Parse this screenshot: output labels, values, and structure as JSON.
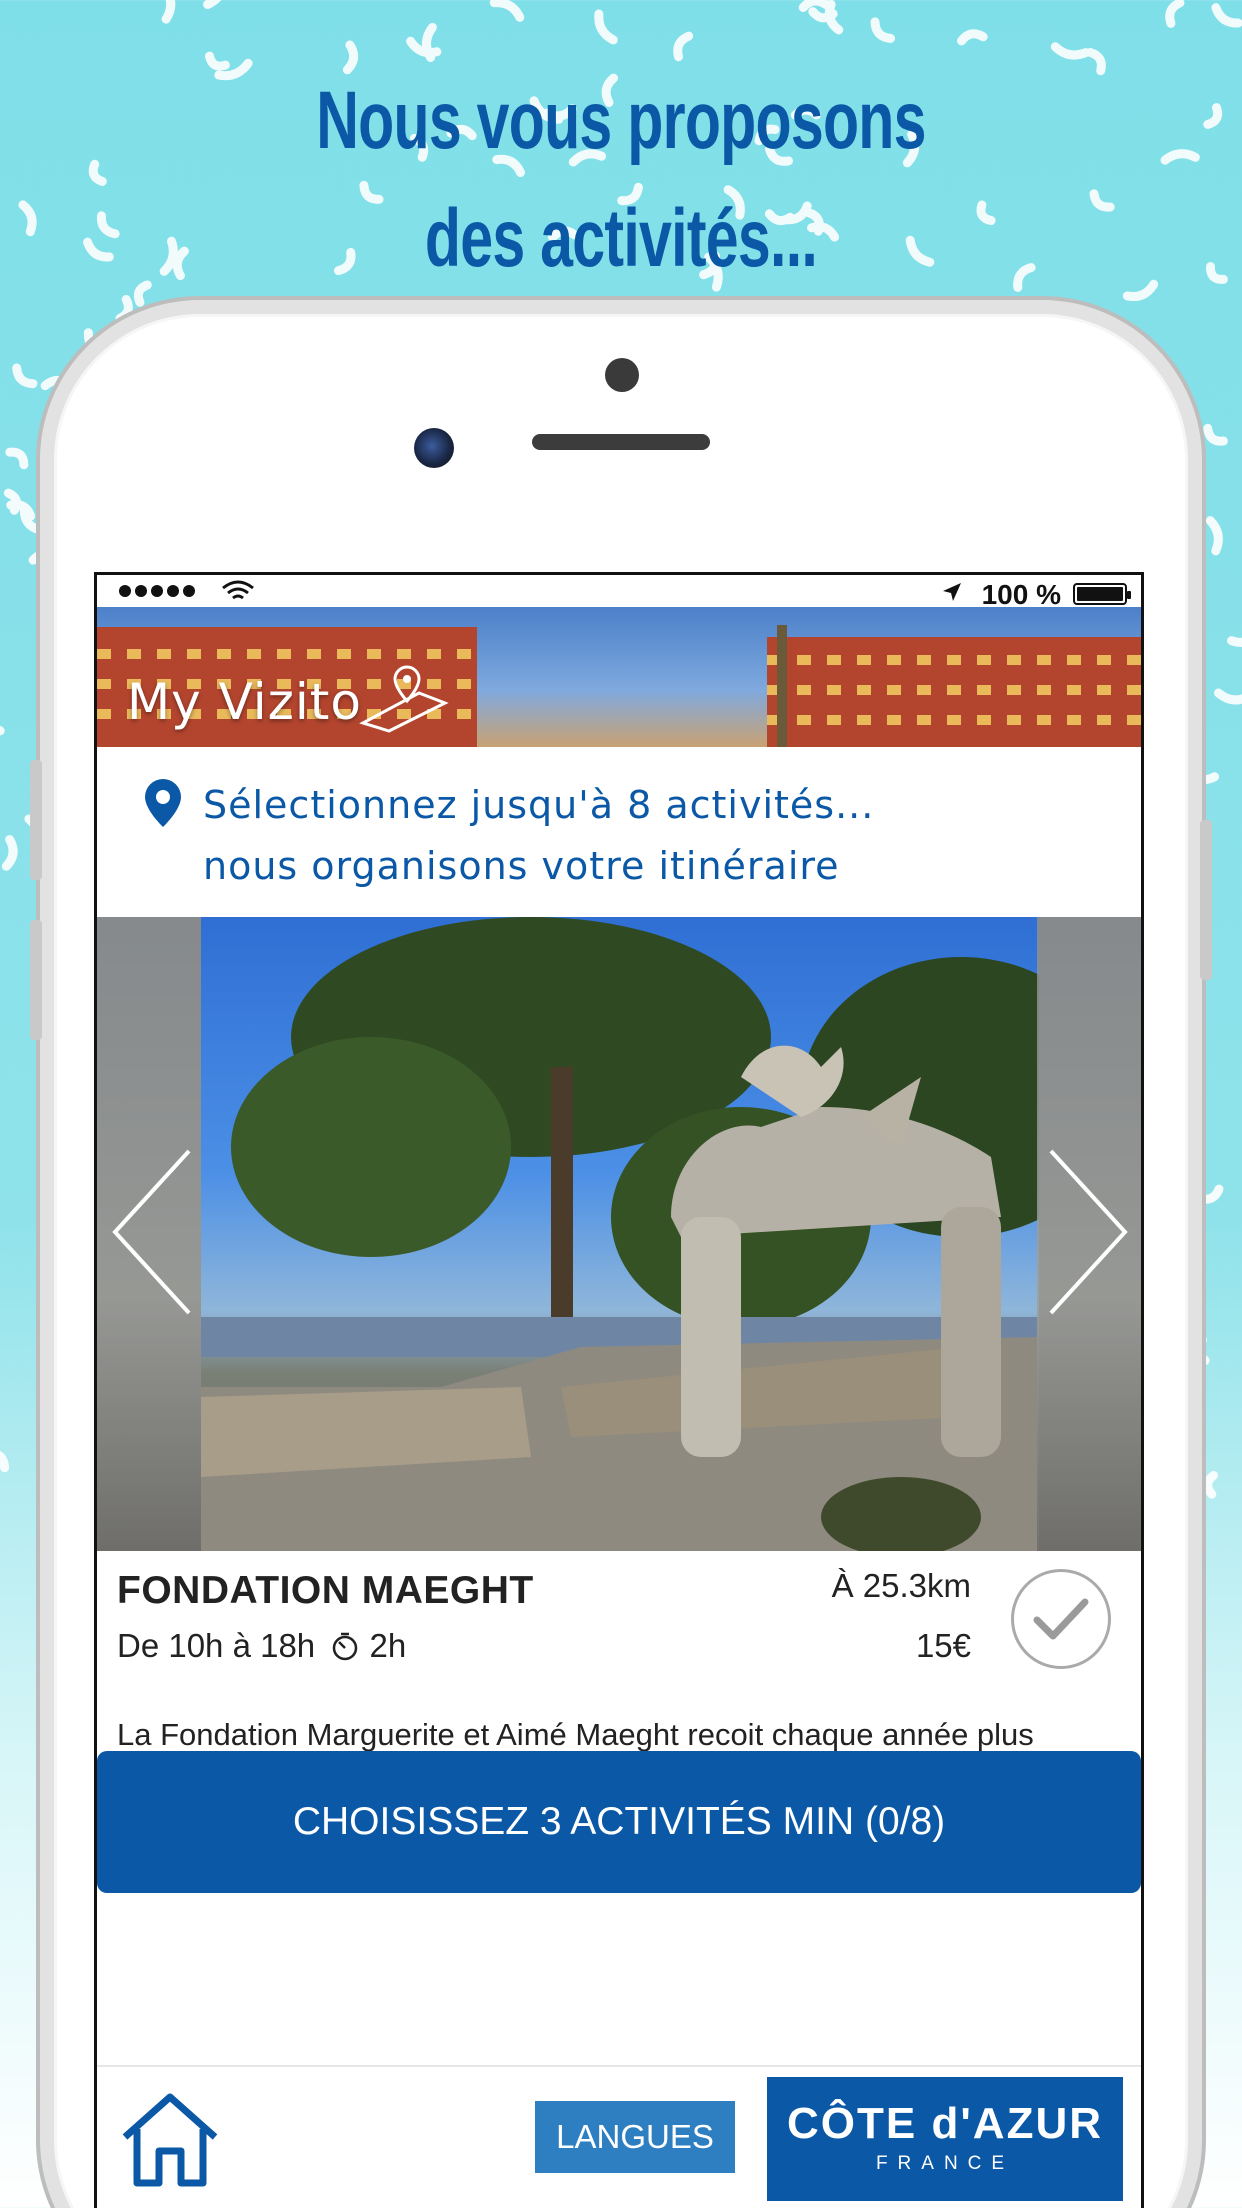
{
  "headline": {
    "line1": "Nous vous proposons",
    "line2": "des activités..."
  },
  "status_bar": {
    "battery_label": "100 %"
  },
  "header": {
    "logo_text": "My Vizito"
  },
  "instruction": {
    "line1": "Sélectionnez jusqu'à 8 activités...",
    "line2": "nous organisons votre itinéraire",
    "icon": "map-pin-icon"
  },
  "activity": {
    "title": "FONDATION MAEGHT",
    "hours": "De 10h à 18h",
    "duration": "2h",
    "distance": "À 25.3km",
    "price": "15€",
    "description": "La Fondation Marguerite et Aimé Maeght recoit chaque année plus",
    "selected": false
  },
  "cta": {
    "label": "CHOISISSEZ 3 ACTIVITÉS MIN (0/8)"
  },
  "bottom_bar": {
    "languages_label": "LANGUES",
    "brand_main": "CÔTE d'AZUR",
    "brand_sub": "FRANCE"
  },
  "colors": {
    "accent": "#0a58a6",
    "background_top": "#7fdfe8",
    "lang_button": "#2d7fc1"
  }
}
